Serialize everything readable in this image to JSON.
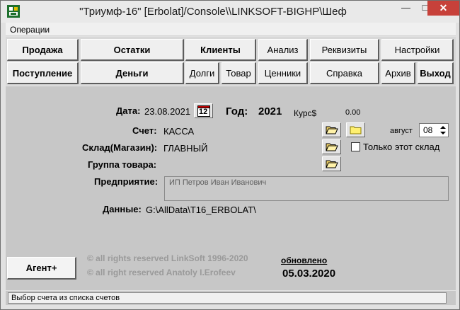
{
  "window": {
    "title": "\"Триумф-16\" [Erbolat]/Console\\\\LINKSOFT-BIGHP\\Шеф",
    "minimize": "—",
    "maximize": "□",
    "close": "✕"
  },
  "menu": {
    "operations": "Операции"
  },
  "toolbar": {
    "row1": {
      "prodazha": "Продажа",
      "ostatki": "Остатки",
      "klienty": "Клиенты",
      "analiz": "Анализ",
      "rekvizity": "Реквизиты",
      "nastroyki": "Настройки"
    },
    "row2": {
      "postuplenie": "Поступление",
      "dengi": "Деньги",
      "dolgi": "Долги",
      "tovar": "Товар",
      "cenniki": "Ценники",
      "spravka": "Справка",
      "arhiv": "Архив",
      "vyhod": "Выход"
    }
  },
  "form": {
    "date_label": "Дата:",
    "date_value": "23.08.2021",
    "calendar_icon_text": "12",
    "year_label": "Год:",
    "year_value": "2021",
    "rate_label": "Курс$",
    "rate_value": "0.00",
    "account_label": "Счет:",
    "account_value": "КАССА",
    "warehouse_label": "Склад(Магазин):",
    "warehouse_value": "ГЛАВНЫЙ",
    "group_label": "Группа товара:",
    "group_value": "",
    "enterprise_label": "Предприятие:",
    "enterprise_value": "ИП Петров Иван Иванович",
    "data_label": "Данные:",
    "data_value": "G:\\AllData\\T16_ERBOLAT\\",
    "month_label": "август",
    "month_value": "08",
    "only_warehouse_label": "Только этот склад"
  },
  "footer": {
    "agent_button": "Агент+",
    "copyright1": "© all rights reserved LinkSoft 1996-2020",
    "copyright2": "© all right reserved Anatoly I.Erofeev",
    "updated_label": "обновлено",
    "updated_date": "05.03.2020"
  },
  "status": {
    "text": "Выбор счета из списка счетов"
  },
  "colors": {
    "panel": "#c7c7c7",
    "button_face": "#efefef",
    "close_red": "#c7413a"
  }
}
